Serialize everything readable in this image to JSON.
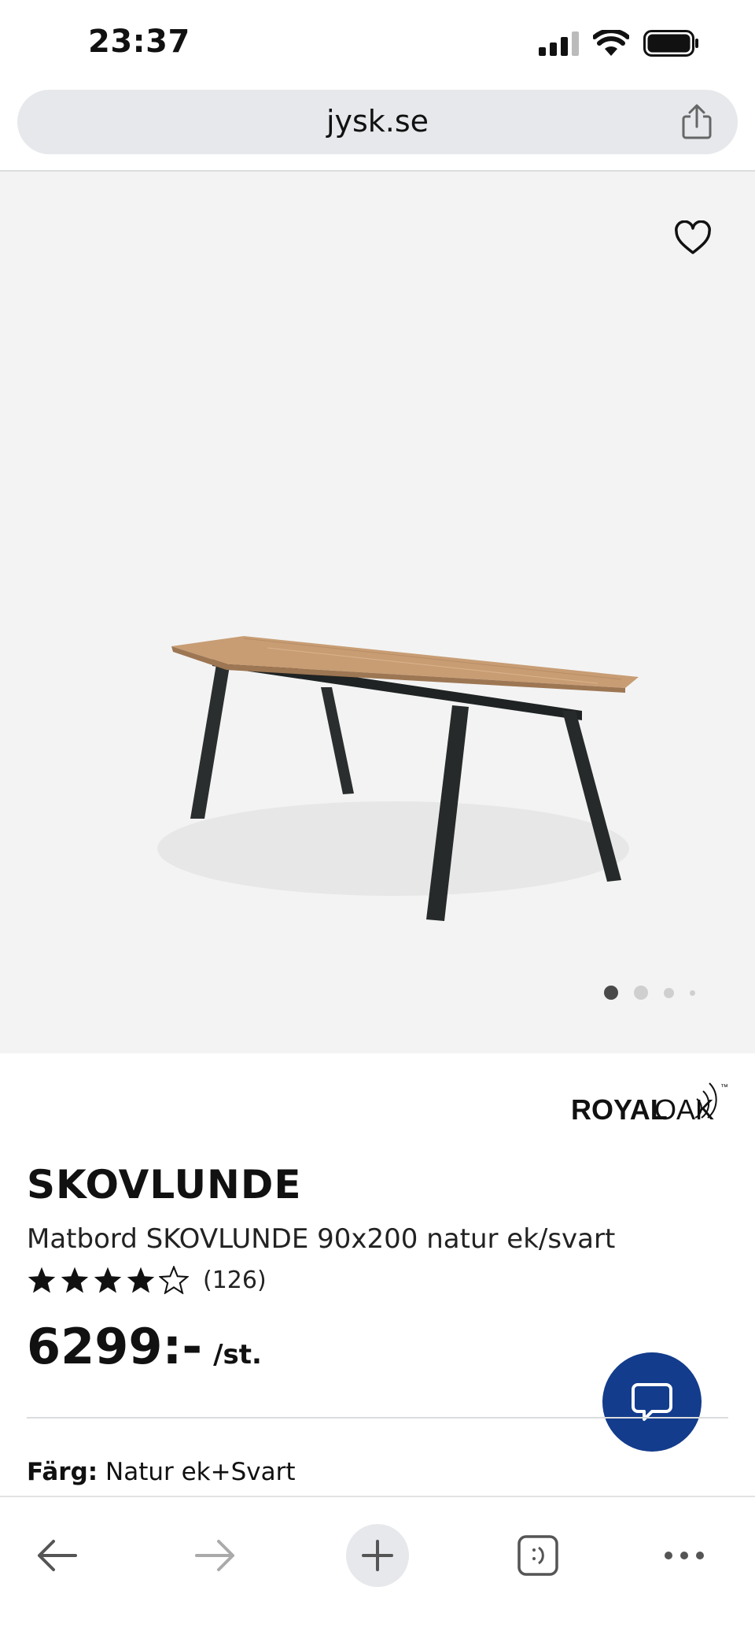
{
  "status": {
    "time": "23:37"
  },
  "browser": {
    "url": "jysk.se"
  },
  "product": {
    "brand": "ROYAL OAK",
    "brand_part1": "ROYAL",
    "brand_part2": "OAK",
    "brand_tm": "™",
    "name": "SKOVLUNDE",
    "description": "Matbord SKOVLUNDE 90x200 natur ek/svart",
    "rating": 4.5,
    "rating_max": 5,
    "review_count": "(126)",
    "price": "6299:-",
    "price_unit": "/st.",
    "color_label": "Färg:",
    "color_value": "Natur ek+Svart",
    "image_pages": 4,
    "image_current": 1
  },
  "icons": {
    "share": "share-icon",
    "favorite": "heart-icon",
    "chat": "chat-icon",
    "back": "arrow-left-icon",
    "forward": "arrow-right-icon",
    "new_tab": "plus-icon",
    "tabs": "tabs-icon",
    "more": "more-icon"
  },
  "colors": {
    "accent": "#143c8c",
    "image_bg": "#f3f3f3",
    "url_bar": "#e6e8eb"
  }
}
